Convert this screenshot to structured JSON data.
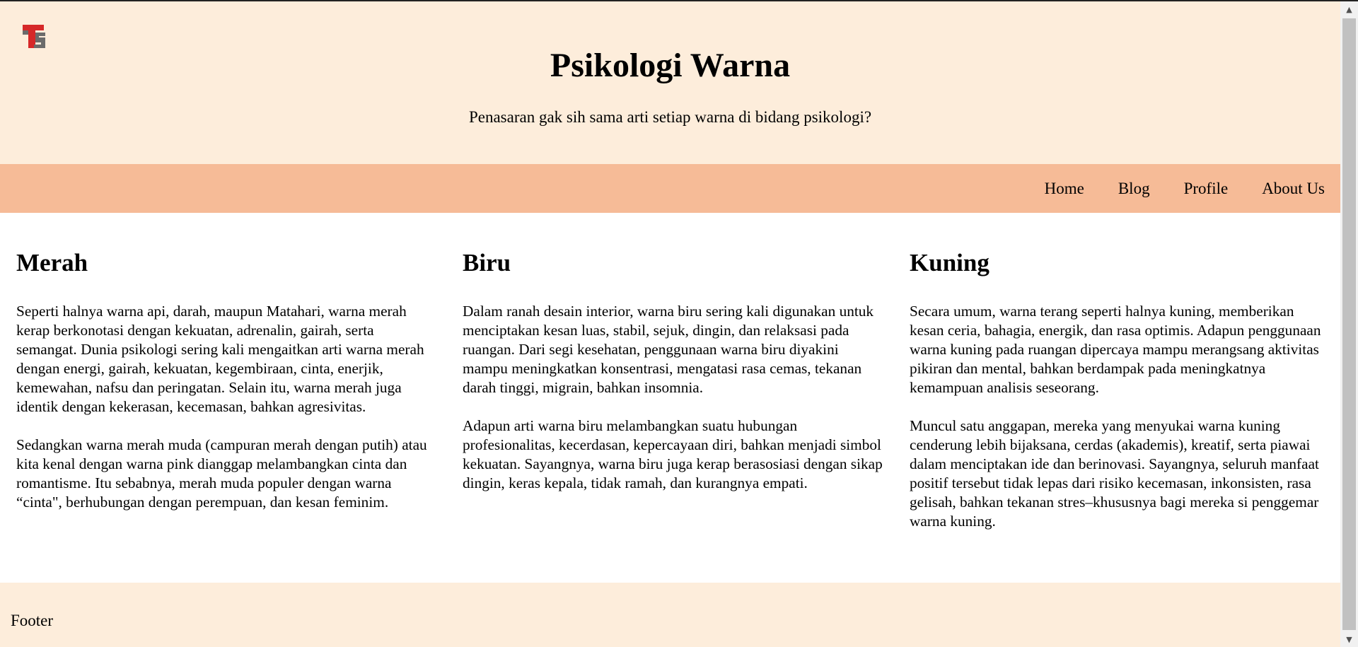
{
  "header": {
    "logo_icon": "ts-logo-icon",
    "title": "Psikologi Warna",
    "subtitle": "Penasaran gak sih sama arti setiap warna di bidang psikologi?"
  },
  "nav": {
    "items": [
      {
        "label": "Home"
      },
      {
        "label": "Blog"
      },
      {
        "label": "Profile"
      },
      {
        "label": "About Us"
      }
    ]
  },
  "sections": [
    {
      "heading": "Merah",
      "paragraphs": [
        "Seperti halnya warna api, darah, maupun Matahari, warna merah kerap berkonotasi dengan kekuatan, adrenalin, gairah, serta semangat. Dunia psikologi sering kali mengaitkan arti warna merah dengan energi, gairah, kekuatan, kegembiraan, cinta, enerjik, kemewahan, nafsu dan peringatan. Selain itu, warna merah juga identik dengan kekerasan, kecemasan, bahkan agresivitas.",
        "Sedangkan warna merah muda (campuran merah dengan putih) atau kita kenal dengan warna pink dianggap melambangkan cinta dan romantisme. Itu sebabnya, merah muda populer dengan warna “cinta\", berhubungan dengan perempuan, dan kesan feminim."
      ]
    },
    {
      "heading": "Biru",
      "paragraphs": [
        "Dalam ranah desain interior, warna biru sering kali digunakan untuk menciptakan kesan luas, stabil, sejuk, dingin, dan relaksasi pada ruangan. Dari segi kesehatan, penggunaan warna biru diyakini mampu meningkatkan konsentrasi, mengatasi rasa cemas, tekanan darah tinggi, migrain, bahkan insomnia.",
        "Adapun arti warna biru melambangkan suatu hubungan profesionalitas, kecerdasan, kepercayaan diri, bahkan menjadi simbol kekuatan. Sayangnya, warna biru juga kerap berasosiasi dengan sikap dingin, keras kepala, tidak ramah, dan kurangnya empati."
      ]
    },
    {
      "heading": "Kuning",
      "paragraphs": [
        "Secara umum, warna terang seperti halnya kuning, memberikan kesan ceria, bahagia, energik, dan rasa optimis. Adapun penggunaan warna kuning pada ruangan dipercaya mampu merangsang aktivitas pikiran dan mental, bahkan berdampak pada meningkatnya kemampuan analisis seseorang.",
        "Muncul satu anggapan, mereka yang menyukai warna kuning cenderung lebih bijaksana, cerdas (akademis), kreatif, serta piawai dalam menciptakan ide dan berinovasi. Sayangnya, seluruh manfaat positif tersebut tidak lepas dari risiko kecemasan, inkonsisten, rasa gelisah, bahkan tekanan stres–khususnya bagi mereka si penggemar warna kuning."
      ]
    }
  ],
  "footer": {
    "text": "Footer"
  },
  "colors": {
    "header_bg": "#fdeddb",
    "nav_bg": "#f6bb97",
    "footer_bg": "#fdeddb",
    "logo_red": "#d62828",
    "logo_gray": "#6b6b6b"
  },
  "scrollbar": {
    "up_icon": "scroll-up-arrow-icon",
    "down_icon": "scroll-down-arrow-icon"
  }
}
